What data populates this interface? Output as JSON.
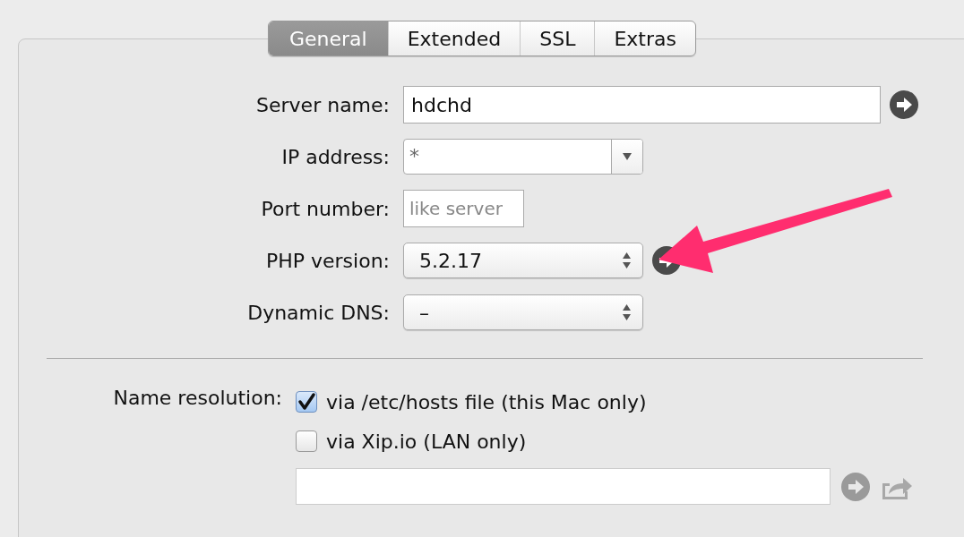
{
  "tabs": [
    {
      "label": "General",
      "selected": true
    },
    {
      "label": "Extended",
      "selected": false
    },
    {
      "label": "SSL",
      "selected": false
    },
    {
      "label": "Extras",
      "selected": false
    }
  ],
  "fields": [
    {
      "kind": "text",
      "label": "Server name:",
      "value": "hdchd",
      "go_button": true
    },
    {
      "kind": "combo",
      "label": "IP address:",
      "value": "*"
    },
    {
      "kind": "short",
      "label": "Port number:",
      "placeholder": "like server"
    },
    {
      "kind": "select",
      "label": "PHP version:",
      "value": "5.2.17",
      "go_button": true
    },
    {
      "kind": "select",
      "label": "Dynamic DNS:",
      "value": "–"
    }
  ],
  "name_resolution": {
    "label": "Name resolution:",
    "options": [
      {
        "label": "via /etc/hosts file (this Mac only)",
        "checked": true
      },
      {
        "label": "via Xip.io (LAN only)",
        "checked": false
      }
    ]
  }
}
